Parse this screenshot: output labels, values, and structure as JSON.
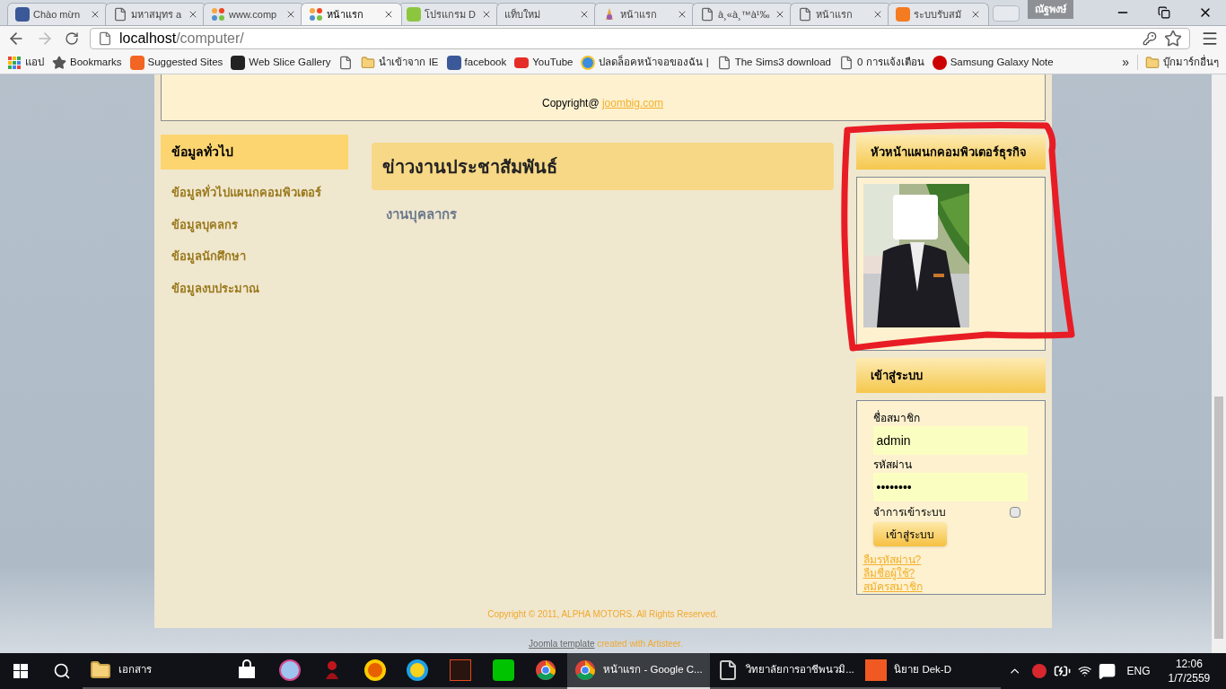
{
  "browser": {
    "tabs": [
      {
        "title": "Chào mừn",
        "kind": "facebook",
        "selected": false
      },
      {
        "title": "มหาสมุทร a",
        "kind": "page",
        "selected": false
      },
      {
        "title": "www.comp",
        "kind": "joomla",
        "selected": false
      },
      {
        "title": "หน้าแรก",
        "kind": "joomla",
        "selected": true
      },
      {
        "title": "โปรแกรม D",
        "kind": "dd",
        "selected": false
      },
      {
        "title": "แท็บใหม่",
        "kind": "none",
        "selected": false
      },
      {
        "title": "หน้าแรก",
        "kind": "temple",
        "selected": false
      },
      {
        "title": "à¸«à¸™à¹‰",
        "kind": "page",
        "selected": false
      },
      {
        "title": "หน้าแรก",
        "kind": "page",
        "selected": false
      },
      {
        "title": "ระบบรับสมั",
        "kind": "orange",
        "selected": false
      }
    ],
    "profile": "ณัฐพงษ์",
    "address": {
      "host": "localhost",
      "path": "/computer/"
    },
    "bookmarks": [
      {
        "label": "แอป",
        "kind": "apps"
      },
      {
        "label": "Bookmarks",
        "kind": "star"
      },
      {
        "label": "Suggested Sites",
        "kind": "bulb"
      },
      {
        "label": "Web Slice Gallery",
        "kind": "slice"
      },
      {
        "kind": "page"
      },
      {
        "label": "นำเข้าจาก IE",
        "kind": "folder"
      },
      {
        "label": "facebook",
        "kind": "facebook"
      },
      {
        "label": "YouTube",
        "kind": "youtube"
      },
      {
        "label": "ปลดล็อคหน้าจอของฉัน |",
        "kind": "globe"
      },
      {
        "label": "The Sims3 download",
        "kind": "page"
      },
      {
        "label": "0 การแจ้งเตือน",
        "kind": "page"
      },
      {
        "label": "Samsung Galaxy Note",
        "kind": "red-circle"
      }
    ],
    "more": "»",
    "other_bookmarks": "บุ๊กมาร์กอื่นๆ"
  },
  "page": {
    "top_banner": {
      "text": "Copyright@",
      "link": "joombig.com"
    },
    "left_menu": {
      "title": "ข้อมูลทั่วไป",
      "items": [
        "ข้อมูลทั่วไปแผนกคอมพิวเตอร์",
        "ข้อมูลบุคลกร",
        "ข้อมูลนักศึกษา",
        "ข้อมูลงบประมาณ"
      ]
    },
    "article": {
      "title": "ข่าวงานประชาสัมพันธ์",
      "subtitle": "งานบุคลากร"
    },
    "staff_module": {
      "title": "หัวหน้าแผนกคอมพิวเตอร์ธุรกิจ"
    },
    "login": {
      "title": "เข้าสู่ระบบ",
      "username_label": "ชื่อสมาชิก",
      "username": "admin",
      "password_label": "รหัสผ่าน",
      "password": "••••••••",
      "remember_label": "จำการเข้าระบบ",
      "remember": false,
      "submit": "เข้าสู่ระบบ",
      "links": [
        "ลืมรหัสผ่าน?",
        "ลืมชื่อผู้ใช้?",
        "สมัครสมาชิก"
      ]
    },
    "footer": "Copyright © 2011, ALPHA MOTORS. All Rights Reserved.",
    "credit": {
      "link": "Joomla template",
      "text": "created with Artisteer."
    }
  },
  "taskbar": {
    "items": [
      {
        "kind": "explorer",
        "label": "เอกสาร",
        "selected": false
      },
      {
        "kind": "store",
        "selected": false
      },
      {
        "kind": "browser",
        "selected": false
      },
      {
        "kind": "ninja",
        "selected": false
      },
      {
        "kind": "firefox",
        "selected": false
      },
      {
        "kind": "ie",
        "selected": false
      },
      {
        "kind": "game",
        "selected": false
      },
      {
        "kind": "line",
        "selected": false
      },
      {
        "kind": "chrome",
        "selected": false
      },
      {
        "kind": "chrome",
        "label": "หน้าแรก - Google C...",
        "selected": true
      },
      {
        "kind": "doc",
        "label": "วิทยาลัยการอาชีพนวมิ...",
        "selected": false
      },
      {
        "kind": "dekd",
        "label": "นิยาย Dek-D",
        "selected": false
      }
    ],
    "language": "ENG",
    "time": "12:06",
    "date": "1/7/2559"
  }
}
